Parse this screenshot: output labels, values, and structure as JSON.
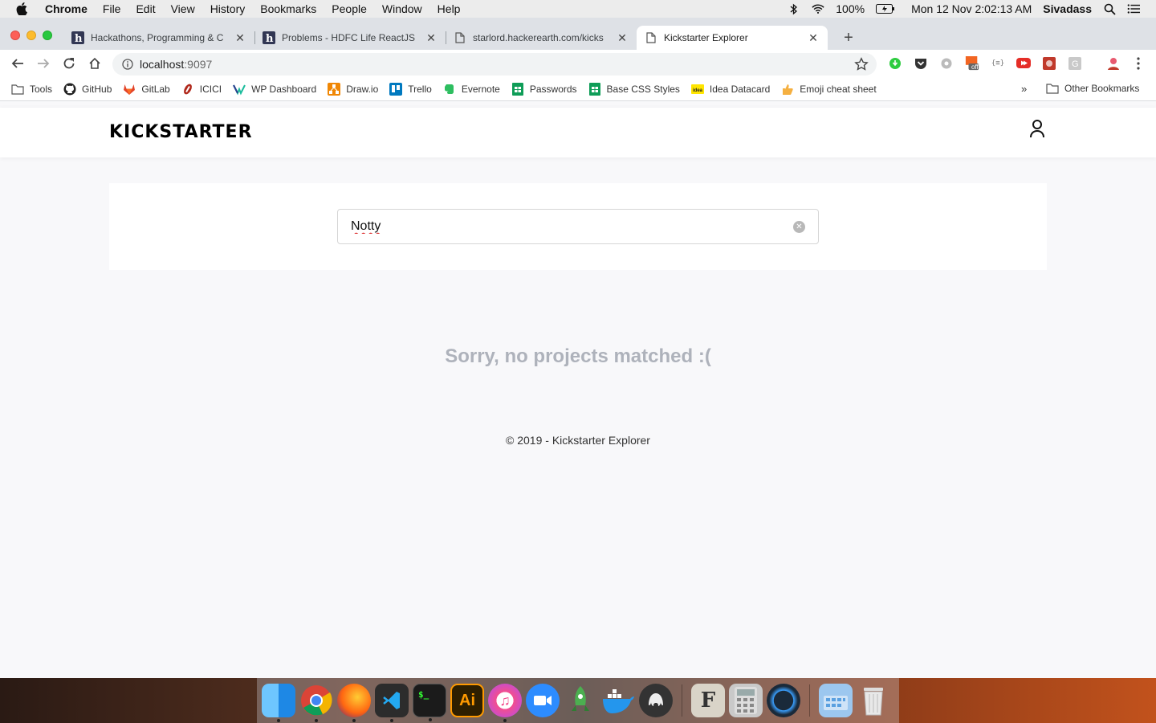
{
  "menubar": {
    "items": [
      "Chrome",
      "File",
      "Edit",
      "View",
      "History",
      "Bookmarks",
      "People",
      "Window",
      "Help"
    ],
    "battery": "100%",
    "datetime": "Mon 12 Nov  2:02:13 AM",
    "user": "Sivadass"
  },
  "tabs": [
    {
      "title": "Hackathons, Programming & C",
      "icon": "hackerearth-icon"
    },
    {
      "title": "Problems - HDFC Life ReactJS",
      "icon": "hackerearth-icon"
    },
    {
      "title": "starlord.hackerearth.com/kicks",
      "icon": "page-icon"
    },
    {
      "title": "Kickstarter Explorer",
      "icon": "page-icon"
    }
  ],
  "address": {
    "host": "localhost",
    "port": ":9097"
  },
  "bookmarks": [
    "Tools",
    "GitHub",
    "GitLab",
    "ICICI",
    "WP Dashboard",
    "Draw.io",
    "Trello",
    "Evernote",
    "Passwords",
    "Base CSS Styles",
    "Idea Datacard",
    "Emoji cheat sheet"
  ],
  "other_bookmarks": "Other Bookmarks",
  "more_bookmarks": "»",
  "site": {
    "logo": "KICKSTARTER",
    "search_value": "Notty",
    "empty_message": "Sorry, no projects matched :(",
    "footer": "© 2019 - Kickstarter Explorer"
  },
  "extension_badge": "off",
  "dock_apps": [
    "Finder",
    "Chrome",
    "Firefox",
    "VS Code",
    "Terminal",
    "Illustrator",
    "iTunes",
    "Zoom",
    "Rocket",
    "Docker",
    "TablePlus",
    "Font Book",
    "Calculator",
    "QuickTime",
    "Downloads",
    "Trash"
  ]
}
